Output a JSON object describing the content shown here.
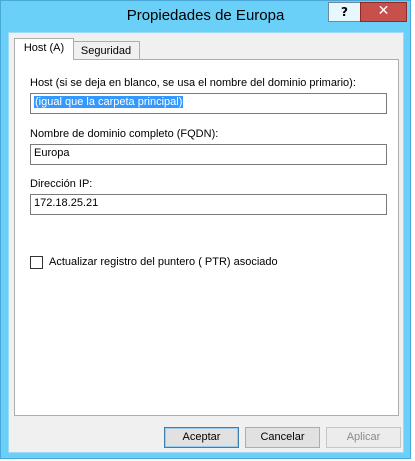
{
  "window": {
    "title": "Propiedades de Europa",
    "help_label": "?",
    "close_label": "✕"
  },
  "tabs": [
    {
      "label": "Host (A)",
      "active": true
    },
    {
      "label": "Seguridad",
      "active": false
    }
  ],
  "form": {
    "host_label": "Host (si se deja en blanco, se usa el nombre del dominio primario):",
    "host_value": "(igual que la carpeta principal)",
    "fqdn_label": "Nombre de dominio completo (FQDN):",
    "fqdn_value": "Europa",
    "ip_label": "Dirección IP:",
    "ip_value": "172.18.25.21",
    "ptr_label": "Actualizar registro del puntero ( PTR) asociado",
    "ptr_checked": false
  },
  "buttons": {
    "ok": "Aceptar",
    "cancel": "Cancelar",
    "apply": "Aplicar"
  },
  "colors": {
    "titlebar": "#6ad0f8",
    "close": "#c7504a",
    "selection": "#3399ff"
  }
}
